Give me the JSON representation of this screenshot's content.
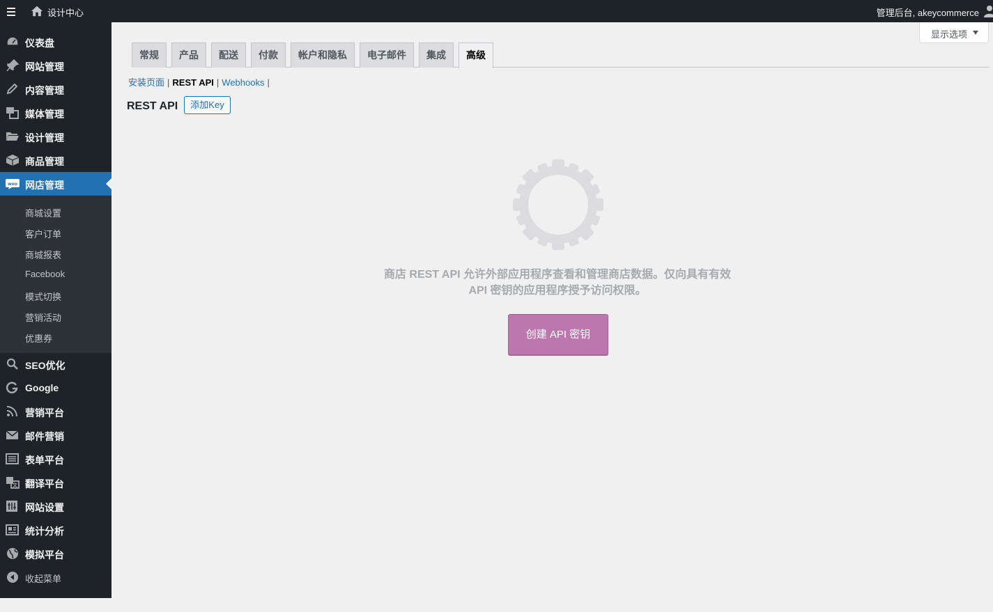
{
  "adminbar": {
    "site_name": "设计中心",
    "account": "管理后台, akeycommerce"
  },
  "sidebar": {
    "items": [
      {
        "label": "仪表盘",
        "icon": "dashboard-icon"
      },
      {
        "label": "网站管理",
        "icon": "pin-icon"
      },
      {
        "label": "内容管理",
        "icon": "pencil-icon"
      },
      {
        "label": "媒体管理",
        "icon": "media-icon"
      },
      {
        "label": "设计管理",
        "icon": "folder-icon"
      },
      {
        "label": "商品管理",
        "icon": "box-icon"
      },
      {
        "label": "网店管理",
        "icon": "woo-icon",
        "active": true
      }
    ],
    "submenu": [
      "商城设置",
      "客户订单",
      "商城报表",
      "Facebook",
      "模式切换",
      "营销活动",
      "优惠券"
    ],
    "items_after": [
      {
        "label": "SEO优化",
        "icon": "search-icon"
      },
      {
        "label": "Google",
        "icon": "google-icon"
      },
      {
        "label": "营销平台",
        "icon": "rss-icon"
      },
      {
        "label": "邮件营销",
        "icon": "mail-icon"
      },
      {
        "label": "表单平台",
        "icon": "form-icon"
      },
      {
        "label": "翻译平台",
        "icon": "translate-icon"
      },
      {
        "label": "网站设置",
        "icon": "settings-icon"
      },
      {
        "label": "统计分析",
        "icon": "stats-icon"
      },
      {
        "label": "模拟平台",
        "icon": "globe-icon"
      }
    ],
    "collapse": "收起菜单"
  },
  "screen_options": "显示选项",
  "tabs": [
    "常规",
    "产品",
    "配送",
    "付款",
    "帐户和隐私",
    "电子邮件",
    "集成",
    "高级"
  ],
  "active_tab": "高级",
  "subnav": {
    "install_pages": "安装页面",
    "rest_api": "REST API",
    "webhooks": "Webhooks"
  },
  "heading": "REST API",
  "add_key": "添加Key",
  "empty_message_line1": "商店 REST API 允许外部应用程序查看和管理商店数据。仅向具有有效",
  "empty_message_line2": "API 密钥的应用程序授予访问权限。",
  "create_button": "创建 API 密钥",
  "colors": {
    "adminbar": "#1d2327",
    "active_menu": "#2271b1",
    "woo_purple": "#bb77ae",
    "link": "#2271b1"
  }
}
